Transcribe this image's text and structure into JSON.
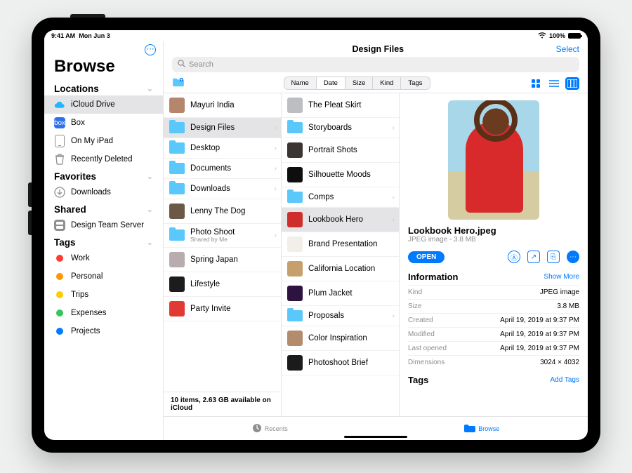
{
  "status": {
    "time": "9:41 AM",
    "date": "Mon Jun 3",
    "battery": "100%"
  },
  "sidebar": {
    "title": "Browse",
    "sections": {
      "locations": "Locations",
      "favorites": "Favorites",
      "shared": "Shared",
      "tags": "Tags"
    },
    "locations": [
      {
        "label": "iCloud Drive",
        "type": "cloud",
        "selected": true
      },
      {
        "label": "Box",
        "type": "box"
      },
      {
        "label": "On My iPad",
        "type": "ipad"
      },
      {
        "label": "Recently Deleted",
        "type": "trash"
      }
    ],
    "favorites": [
      {
        "label": "Downloads"
      }
    ],
    "shared": [
      {
        "label": "Design Team Server"
      }
    ],
    "tags": [
      {
        "label": "Work",
        "color": "#ff3b30"
      },
      {
        "label": "Personal",
        "color": "#ff9500"
      },
      {
        "label": "Trips",
        "color": "#ffcc00"
      },
      {
        "label": "Expenses",
        "color": "#34c759"
      },
      {
        "label": "Projects",
        "color": "#007aff"
      }
    ]
  },
  "header": {
    "title": "Design Files",
    "select": "Select",
    "search_placeholder": "Search"
  },
  "sort": {
    "options": [
      "Name",
      "Date",
      "Size",
      "Kind",
      "Tags"
    ],
    "selected": "Date"
  },
  "columns": {
    "c1": [
      {
        "label": "Mayuri India",
        "kind": "image",
        "color": "#b5866b"
      },
      {
        "label": "Design Files",
        "kind": "folder",
        "selected": true
      },
      {
        "label": "Desktop",
        "kind": "folder"
      },
      {
        "label": "Documents",
        "kind": "folder"
      },
      {
        "label": "Downloads",
        "kind": "folder"
      },
      {
        "label": "Lenny The Dog",
        "kind": "image",
        "color": "#6b5846"
      },
      {
        "label": "Photo Shoot",
        "kind": "folder",
        "sub": "Shared by Me"
      },
      {
        "label": "Spring Japan",
        "kind": "image",
        "color": "#b7adae"
      },
      {
        "label": "Lifestyle",
        "kind": "image",
        "color": "#1c1c1e"
      },
      {
        "label": "Party Invite",
        "kind": "image",
        "color": "#e13a33"
      }
    ],
    "c1_footer": "10 items, 2.63 GB available on iCloud",
    "c2": [
      {
        "label": "The Pleat Skirt",
        "kind": "image",
        "color": "#bdbec1"
      },
      {
        "label": "Storyboards",
        "kind": "folder"
      },
      {
        "label": "Portrait Shots",
        "kind": "image",
        "color": "#3a3532"
      },
      {
        "label": "Silhouette Moods",
        "kind": "image",
        "color": "#0e0e0f"
      },
      {
        "label": "Comps",
        "kind": "folder"
      },
      {
        "label": "Lookbook Hero",
        "kind": "image",
        "color": "#cf2f2b",
        "selected": true
      },
      {
        "label": "Brand Presentation",
        "kind": "image",
        "color": "#f2efe8"
      },
      {
        "label": "California Location",
        "kind": "image",
        "color": "#c6a06c"
      },
      {
        "label": "Plum Jacket",
        "kind": "image",
        "color": "#2e1340"
      },
      {
        "label": "Proposals",
        "kind": "folder"
      },
      {
        "label": "Color Inspiration",
        "kind": "image",
        "color": "#b38b6d"
      },
      {
        "label": "Photoshoot Brief",
        "kind": "image",
        "color": "#1b1b1c"
      }
    ]
  },
  "preview": {
    "filename": "Lookbook Hero.jpeg",
    "subtitle": "JPEG image - 3.8 MB",
    "open": "OPEN",
    "info_label": "Information",
    "show_more": "Show More",
    "info": [
      {
        "k": "Kind",
        "v": "JPEG image"
      },
      {
        "k": "Size",
        "v": "3.8 MB"
      },
      {
        "k": "Created",
        "v": "April 19, 2019 at 9:37 PM"
      },
      {
        "k": "Modified",
        "v": "April 19, 2019 at 9:37 PM"
      },
      {
        "k": "Last opened",
        "v": "April 19, 2019 at 9:37 PM"
      },
      {
        "k": "Dimensions",
        "v": "3024 × 4032"
      }
    ],
    "tags_label": "Tags",
    "add_tags": "Add Tags"
  },
  "tabbar": {
    "recents": "Recents",
    "browse": "Browse"
  }
}
